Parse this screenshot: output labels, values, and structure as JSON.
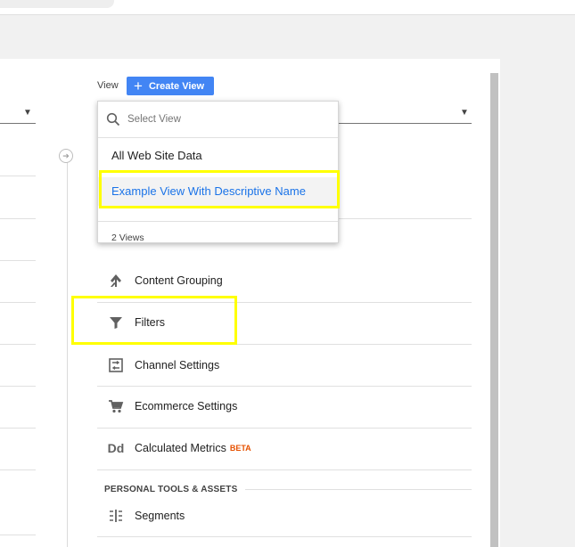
{
  "view_selector": {
    "label": "View",
    "create_button": "Create View",
    "search_placeholder": "Select View",
    "options": [
      "All Web Site Data",
      "Example View With Descriptive Name"
    ],
    "count": "2 Views"
  },
  "settings": {
    "items": [
      {
        "label": "Content Grouping",
        "icon": "content-grouping-icon"
      },
      {
        "label": "Filters",
        "icon": "filter-icon"
      },
      {
        "label": "Channel Settings",
        "icon": "channel-settings-icon"
      },
      {
        "label": "Ecommerce Settings",
        "icon": "shopping-cart-icon"
      },
      {
        "label": "Calculated Metrics",
        "badge": "BETA",
        "icon": "calculated-metrics-icon"
      }
    ],
    "section_title": "PERSONAL TOOLS & ASSETS",
    "section_items": [
      {
        "label": "Segments",
        "icon": "segments-icon"
      }
    ]
  },
  "colors": {
    "accent": "#4285f4",
    "highlight": "#ffff00",
    "link": "#1a73e8",
    "beta": "#e65100"
  }
}
